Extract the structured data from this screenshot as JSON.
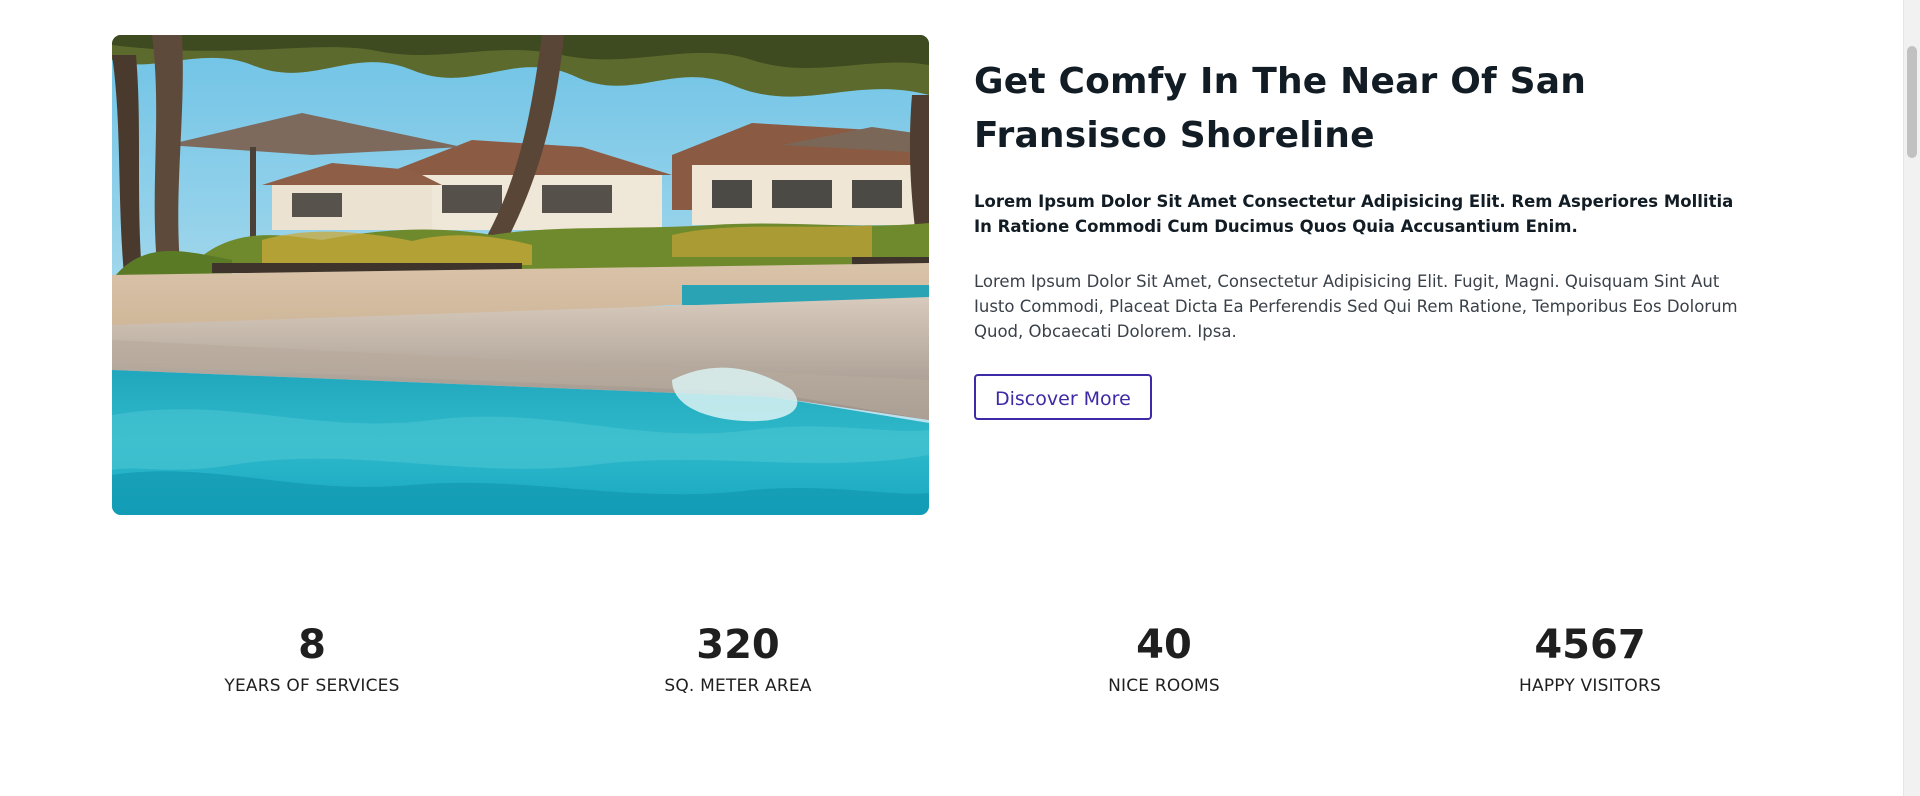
{
  "about": {
    "title": "Get Comfy In The Near Of San Fransisco Shoreline",
    "lead": "Lorem Ipsum Dolor Sit Amet Consectetur Adipisicing Elit. Rem Asperiores Mollitia In Ratione Commodi Cum Ducimus Quos Quia Accusantium Enim.",
    "body": "Lorem Ipsum Dolor Sit Amet, Consectetur Adipisicing Elit. Fugit, Magni. Quisquam Sint Aut Iusto Commodi, Placeat Dicta Ea Perferendis Sed Qui Rem Ratione, Temporibus Eos Dolorum Quod, Obcaecati Dolorem. Ipsa.",
    "button_label": "Discover More",
    "accent_color": "#3d2aa6"
  },
  "stats": [
    {
      "value": "8",
      "label": "YEARS OF SERVICES"
    },
    {
      "value": "320",
      "label": "SQ. METER AREA"
    },
    {
      "value": "40",
      "label": "NICE ROOMS"
    },
    {
      "value": "4567",
      "label": "HAPPY VISITORS"
    }
  ],
  "icons": {
    "photo": "resort-pool-photo"
  }
}
